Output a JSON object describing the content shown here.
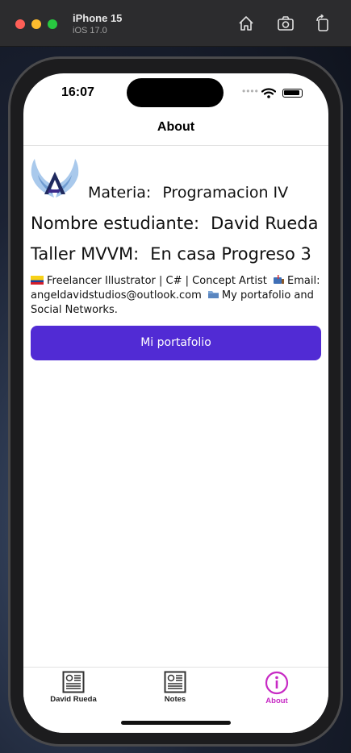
{
  "simulator": {
    "device_name": "iPhone 15",
    "os_version": "iOS 17.0",
    "toolbar_icons": [
      "home-icon",
      "screenshot-icon",
      "rotate-icon"
    ]
  },
  "status_bar": {
    "time": "16:07"
  },
  "nav": {
    "title": "About"
  },
  "content": {
    "materia_label": "Materia:",
    "materia_value": "Programacion IV",
    "nombre_label": "Nombre estudiante:",
    "nombre_value": "David Rueda",
    "taller_label": "Taller MVVM:",
    "taller_value": "En casa Progreso 3",
    "description_part1": "Freelancer Illustrator | C# | Concept Artist",
    "description_part2": "Email: angeldavidstudios@outlook.com",
    "description_part3": "My portafolio and Social Networks.",
    "button_label": "Mi portafolio"
  },
  "tabs": [
    {
      "label": "David Rueda",
      "icon": "newspaper-icon",
      "selected": false
    },
    {
      "label": "Notes",
      "icon": "newspaper-icon",
      "selected": false
    },
    {
      "label": "About",
      "icon": "info-icon",
      "selected": true
    }
  ],
  "colors": {
    "accent": "#512bd4",
    "selected_tab": "#c72ac4"
  }
}
